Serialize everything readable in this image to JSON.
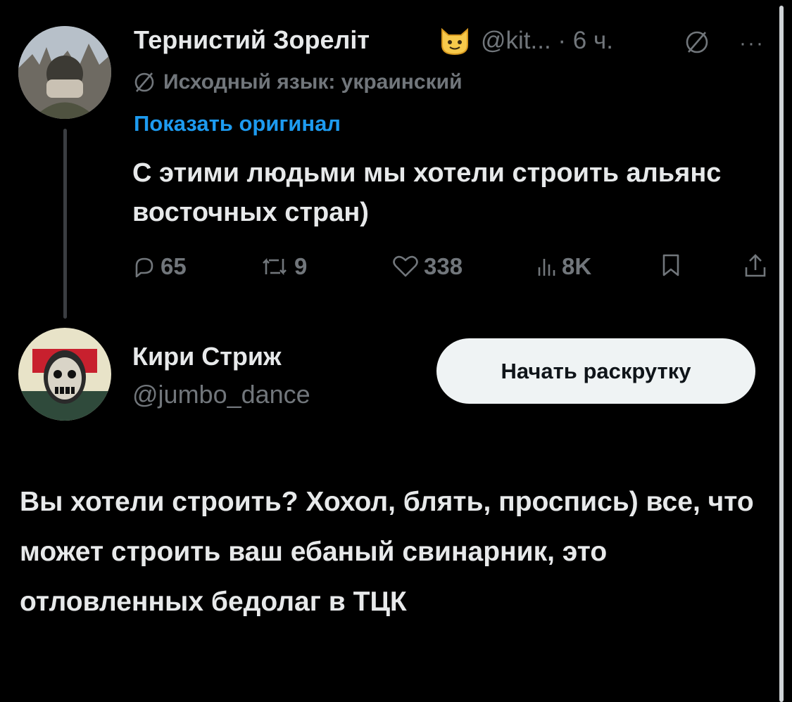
{
  "tweet": {
    "author_name": "Тернистий Зореліт",
    "handle_time": "@kit... · 6 ч.",
    "translation_note": "Исходный язык: украинский",
    "show_original_label": "Показать оригинал",
    "text": "С этими людьми мы хотели строить альянс восточных стран)",
    "replies": "65",
    "reposts": "9",
    "likes": "338",
    "views": "8K"
  },
  "reply": {
    "author_name": "Кири Стриж",
    "handle": "@jumbo_dance",
    "promote_label": "Начать раскрутку",
    "text": "Вы хотели строить? Хохол, блять, проспись) все, что может строить ваш ебаный свинарник, это отловленных бедолаг в ТЦК"
  },
  "icons": {
    "verified_emoji": "cat-emoji-icon",
    "reply": "reply-icon",
    "repost": "repost-icon",
    "like": "heart-icon",
    "views": "views-icon",
    "bookmark": "bookmark-icon",
    "share": "share-icon"
  },
  "colors": {
    "background": "#000000",
    "primary_text": "#e7e9ea",
    "secondary_text": "#71767b",
    "link": "#1d9bf0",
    "button_bg": "#eff3f4"
  }
}
